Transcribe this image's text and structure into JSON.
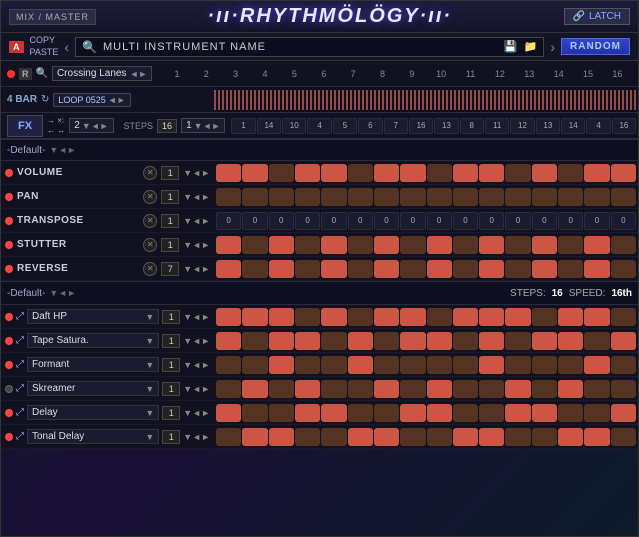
{
  "topBar": {
    "mixMaster": "MIX / MASTER",
    "title": "·ıı·RHYTHMÖLÖGY·ıı·",
    "latchLabel": "LATCH",
    "latchIcon": "🔗"
  },
  "secondBar": {
    "aBadge": "A",
    "copyLabel": "COPY",
    "pasteLabel": "PASTE",
    "instrumentName": "MULTI INSTRUMENT NAME",
    "randomLabel": "RANDOM",
    "leftArrow": "‹",
    "rightArrow": "›"
  },
  "trackRow": {
    "trackName": "Crossing Lanes",
    "rBadge": "R"
  },
  "stepNumbers": [
    "1",
    "2",
    "3",
    "4",
    "5",
    "6",
    "7",
    "8",
    "9",
    "10",
    "11",
    "12",
    "13",
    "14",
    "15",
    "16"
  ],
  "loopSection": {
    "barLabel": "4 BAR",
    "loopName": "LOOP 0525"
  },
  "stepsSection": {
    "stepsLabel": "STEPS",
    "stepsValue": "16",
    "fxLabel": "FX",
    "value1": "2",
    "value2": "1"
  },
  "defaultSection1": {
    "name": "-Default-"
  },
  "params": [
    {
      "name": "VOLUME",
      "value": "1",
      "cells": [
        1,
        1,
        0,
        1,
        1,
        0,
        1,
        1,
        0,
        1,
        1,
        0,
        1,
        0,
        1,
        1
      ]
    },
    {
      "name": "PAN",
      "value": "1",
      "cells": [
        0,
        0,
        0,
        0,
        0,
        0,
        0,
        0,
        0,
        0,
        0,
        0,
        0,
        0,
        0,
        0
      ]
    },
    {
      "name": "TRANSPOSE",
      "value": "1",
      "numbers": [
        "0",
        "0",
        "0",
        "0",
        "0",
        "0",
        "0",
        "0",
        "0",
        "0",
        "0",
        "0",
        "0",
        "0",
        "0",
        "0"
      ]
    },
    {
      "name": "STUTTER",
      "value": "1",
      "cells": [
        1,
        0,
        1,
        0,
        1,
        0,
        1,
        0,
        1,
        0,
        1,
        0,
        1,
        0,
        1,
        0
      ]
    },
    {
      "name": "REVERSE",
      "value": "7",
      "cells": [
        1,
        0,
        1,
        0,
        1,
        0,
        1,
        0,
        1,
        0,
        1,
        0,
        1,
        0,
        1,
        0
      ]
    }
  ],
  "defaultSection2": {
    "name": "-Default-",
    "stepsLabel": "STEPS:",
    "stepsValue": "16",
    "speedLabel": "SPEED:",
    "speedValue": "16th"
  },
  "stepRowNumbers": [
    "1",
    "14",
    "10",
    "4",
    "5",
    "6",
    "7",
    "16",
    "13",
    "8",
    "11",
    "12",
    "13",
    "14",
    "4",
    "16"
  ],
  "instruments": [
    {
      "name": "Daft HP",
      "value": "1",
      "active": true,
      "cells": [
        1,
        1,
        1,
        0,
        1,
        0,
        1,
        1,
        0,
        1,
        1,
        1,
        0,
        1,
        1,
        0
      ]
    },
    {
      "name": "Tape Satura.",
      "value": "1",
      "active": true,
      "cells": [
        1,
        0,
        1,
        1,
        0,
        1,
        0,
        1,
        1,
        0,
        1,
        0,
        1,
        1,
        0,
        1
      ]
    },
    {
      "name": "Formant",
      "value": "1",
      "active": true,
      "cells": [
        0,
        0,
        1,
        0,
        0,
        1,
        0,
        0,
        0,
        0,
        1,
        0,
        0,
        0,
        1,
        0
      ]
    },
    {
      "name": "Skreamer",
      "value": "1",
      "active": false,
      "cells": [
        0,
        1,
        0,
        1,
        0,
        0,
        1,
        0,
        1,
        0,
        0,
        1,
        0,
        1,
        0,
        0
      ]
    },
    {
      "name": "Delay",
      "value": "1",
      "active": true,
      "cells": [
        1,
        0,
        0,
        1,
        1,
        0,
        0,
        1,
        1,
        0,
        0,
        1,
        1,
        0,
        0,
        1
      ]
    },
    {
      "name": "Tonal Delay",
      "value": "1",
      "active": true,
      "cells": [
        0,
        1,
        1,
        0,
        0,
        1,
        1,
        0,
        0,
        1,
        1,
        0,
        0,
        1,
        1,
        0
      ]
    }
  ]
}
